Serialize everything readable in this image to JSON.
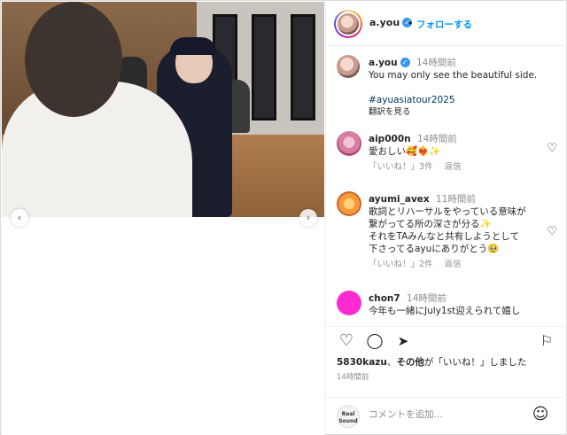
{
  "post": {
    "author": "a.you",
    "follow_label": "フォローする",
    "dot": "•"
  },
  "caption": {
    "author": "a.you",
    "time": "14時間前",
    "text": "You may only see the beautiful side.",
    "hashtag": "#ayuasiatour2025",
    "translate": "翻訳を見る"
  },
  "comments": [
    {
      "user": "aip000n",
      "time": "14時間前",
      "text": "愛おしい🥰❤️‍🔥✨",
      "likes": "「いいね！」3件",
      "reply": "返信"
    },
    {
      "user": "ayumi_avex",
      "time": "11時間前",
      "lines": [
        "歌詞とリハーサルをやっている意味が",
        "繋がってる所の深さが分る✨",
        "それをTAみんなと共有しようとして",
        "下さってるayuにありがとう🥹"
      ],
      "likes": "「いいね！」2件",
      "reply": "返信"
    },
    {
      "user": "chon7",
      "time": "14時間前",
      "text": "今年も一緒にJuly1st迎えられて嬉し"
    }
  ],
  "likes_bar": {
    "count": "5830kazu",
    "and": "、",
    "others": "その他",
    "suffix": "が「いいね！」しました",
    "time": "14時間前"
  },
  "add_comment": {
    "placeholder": "コメントを追加...",
    "logo_text_1": "Real",
    "logo_text_2": "Sound"
  },
  "icons": {
    "verified": "✓",
    "heart_outline": "♡",
    "comment": "◯",
    "share": "➤",
    "bookmark": "⚐",
    "emoji": "☺",
    "prev": "‹",
    "next": "›"
  }
}
